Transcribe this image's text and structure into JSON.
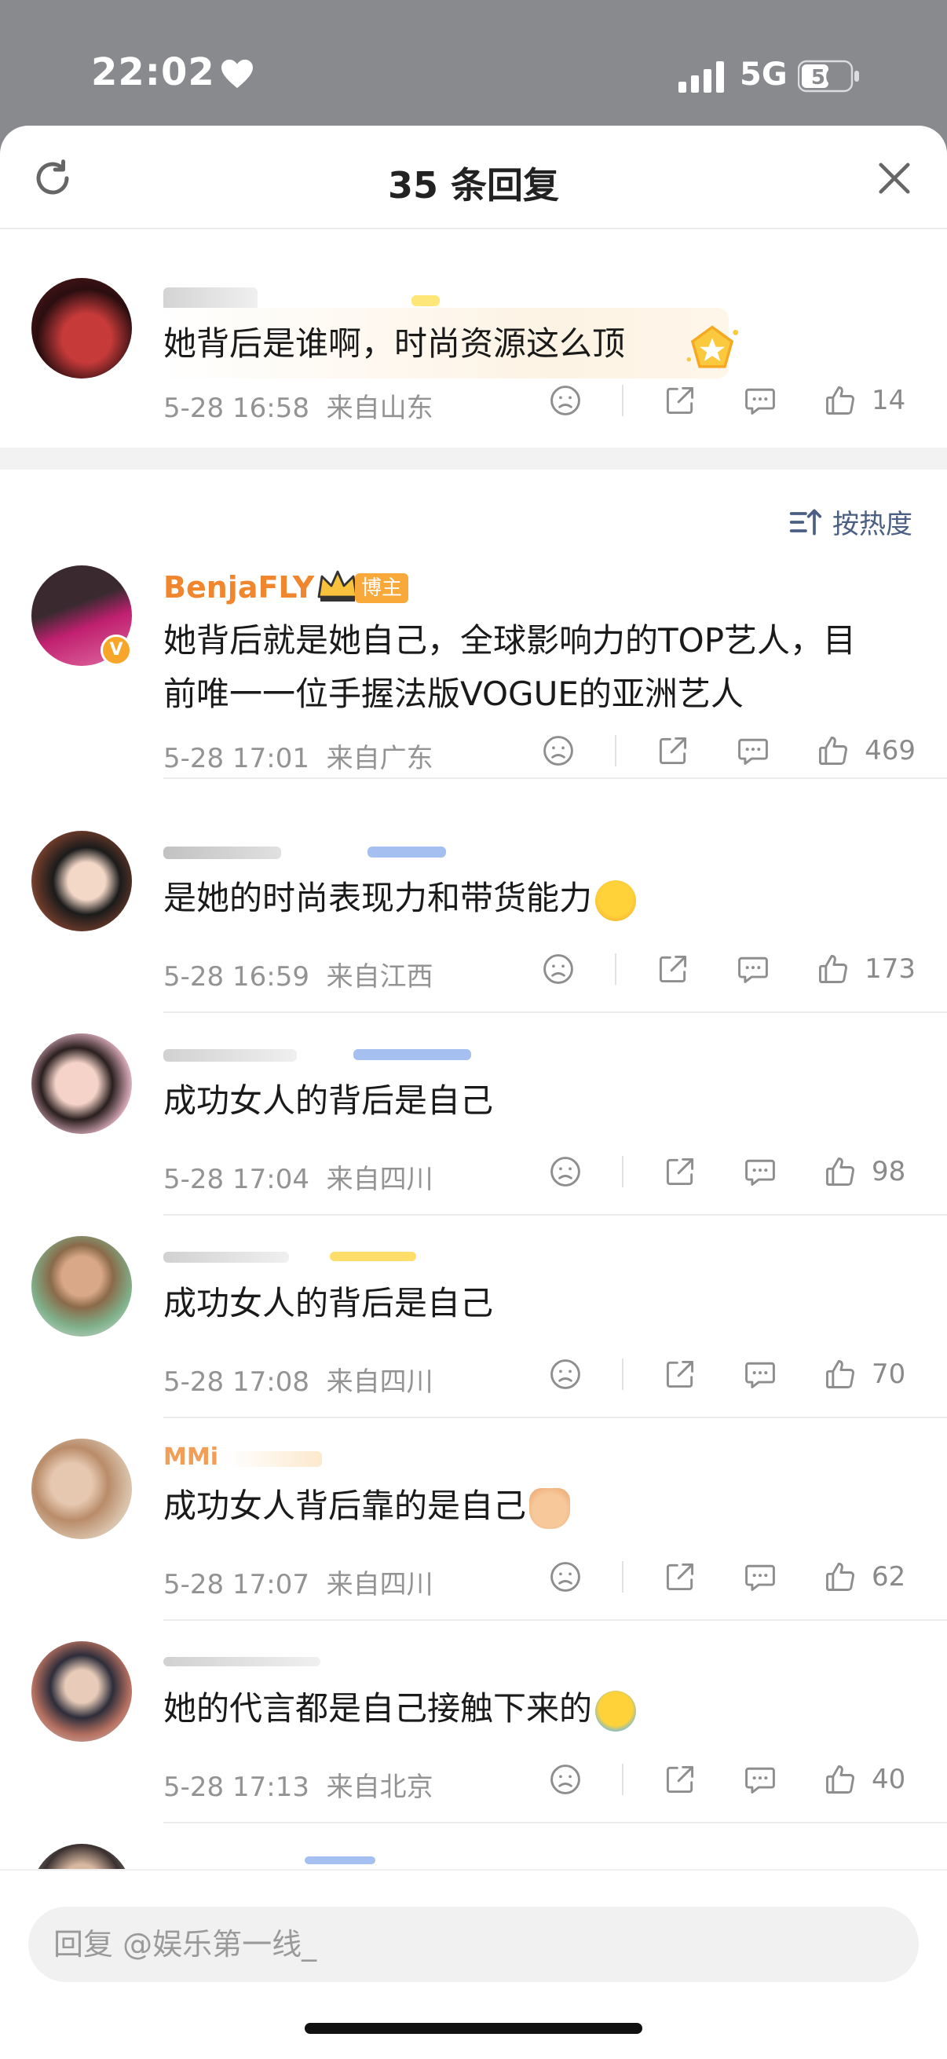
{
  "status": {
    "time": "22:02",
    "network": "5G",
    "battery": "50"
  },
  "sheet": {
    "title": "35 条回复",
    "sort_label": "按热度"
  },
  "root": {
    "text": "她背后是谁啊，时尚资源这么顶",
    "time": "5-28 16:58",
    "location": "来自山东",
    "likes": "14"
  },
  "comments": [
    {
      "username": "BenjaFLY",
      "badge": "博主",
      "text_line1": "她背后就是她自己，全球影响力的TOP艺人，目",
      "text_line2": "前唯一一位手握法版VOGUE的亚洲艺人",
      "time": "5-28 17:01",
      "location": "来自广东",
      "likes": "469"
    },
    {
      "text": "是她的时尚表现力和带货能力",
      "time": "5-28 16:59",
      "location": "来自江西",
      "likes": "173"
    },
    {
      "text": "成功女人的背后是自己",
      "time": "5-28 17:04",
      "location": "来自四川",
      "likes": "98"
    },
    {
      "text": "成功女人的背后是自己",
      "time": "5-28 17:08",
      "location": "来自四川",
      "likes": "70"
    },
    {
      "username_partial": "MMi",
      "text": "成功女人背后靠的是自己",
      "time": "5-28 17:07",
      "location": "来自四川",
      "likes": "62"
    },
    {
      "text": "她的代言都是自己接触下来的",
      "time": "5-28 17:13",
      "location": "来自北京",
      "likes": "40"
    }
  ],
  "reply": {
    "placeholder": "回复 @娱乐第一线_"
  },
  "colors": {
    "username": "#f0862d",
    "meta": "#939393",
    "sort": "#4b5e83"
  }
}
